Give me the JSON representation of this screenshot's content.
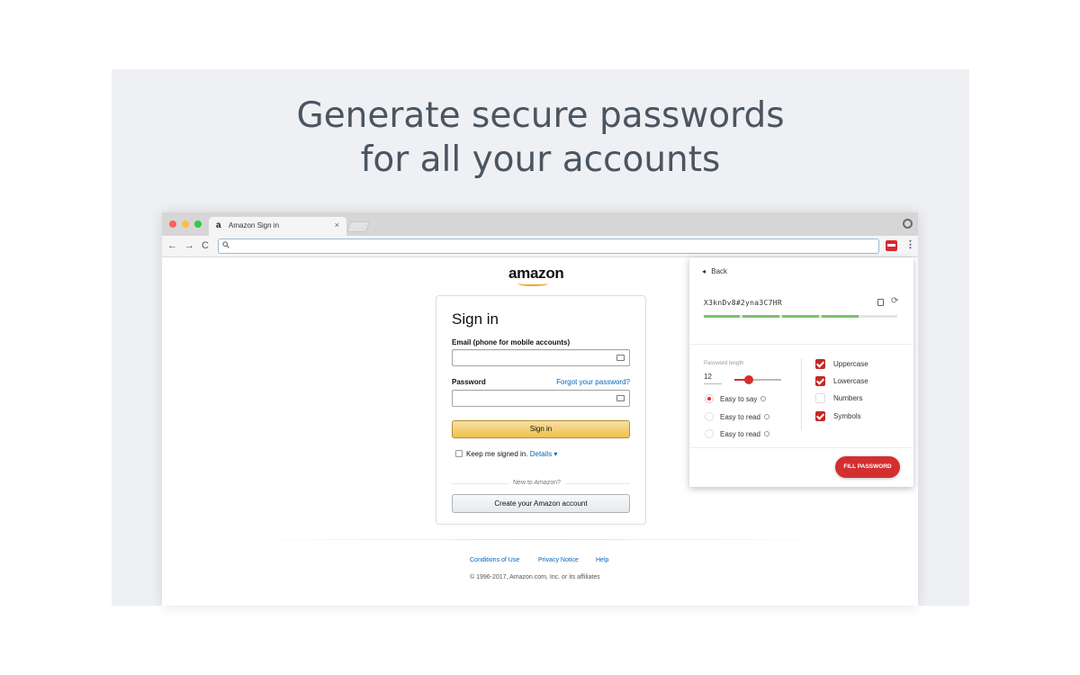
{
  "headline": {
    "line1": "Generate secure passwords",
    "line2": "for all your accounts"
  },
  "browser": {
    "tab_title": "Amazon Sign in",
    "tab_favicon": "a",
    "tab_close": "×",
    "traffic_lights": [
      "#fc605c",
      "#fdbc40",
      "#34c84a"
    ],
    "nav_back": "←",
    "nav_forward": "→",
    "nav_reload": "C",
    "omnibox_value": ""
  },
  "amazon": {
    "logo": "amazon",
    "heading": "Sign in",
    "email_label": "Email (phone for mobile accounts)",
    "email_value": "",
    "password_label": "Password",
    "password_value": "",
    "forgot_link": "Forgot your password?",
    "signin_button": "Sign in",
    "keep_signed_in": "Keep me signed in.",
    "details_link": "Details",
    "details_caret": "▾",
    "new_to": "New to Amazon?",
    "create_button": "Create your Amazon account",
    "footer_links": [
      "Conditions of Use",
      "Privacy Notice",
      "Help"
    ],
    "copyright": "© 1996-2017, Amazon.com, Inc. or its affiliates"
  },
  "generator": {
    "back_icon": "◂",
    "back_label": "Back",
    "password": "X3knDv8#2yna3C7HR",
    "refresh_icon": "⟳",
    "strength_fraction": 0.8,
    "length_label": "Password length",
    "length_value": "12",
    "length_slider_fraction": 0.3,
    "modes": [
      {
        "label": "Easy to say",
        "selected": true
      },
      {
        "label": "Easy to read",
        "selected": false
      },
      {
        "label": "Easy to read",
        "selected": false
      }
    ],
    "options": [
      {
        "label": "Uppercase",
        "checked": true
      },
      {
        "label": "Lowercase",
        "checked": true
      },
      {
        "label": "Numbers",
        "checked": false
      },
      {
        "label": "Symbols",
        "checked": true
      }
    ],
    "fill_button": "FILL PASSWORD",
    "accent_color": "#d32f2f",
    "strength_color": "#7cc36b"
  }
}
